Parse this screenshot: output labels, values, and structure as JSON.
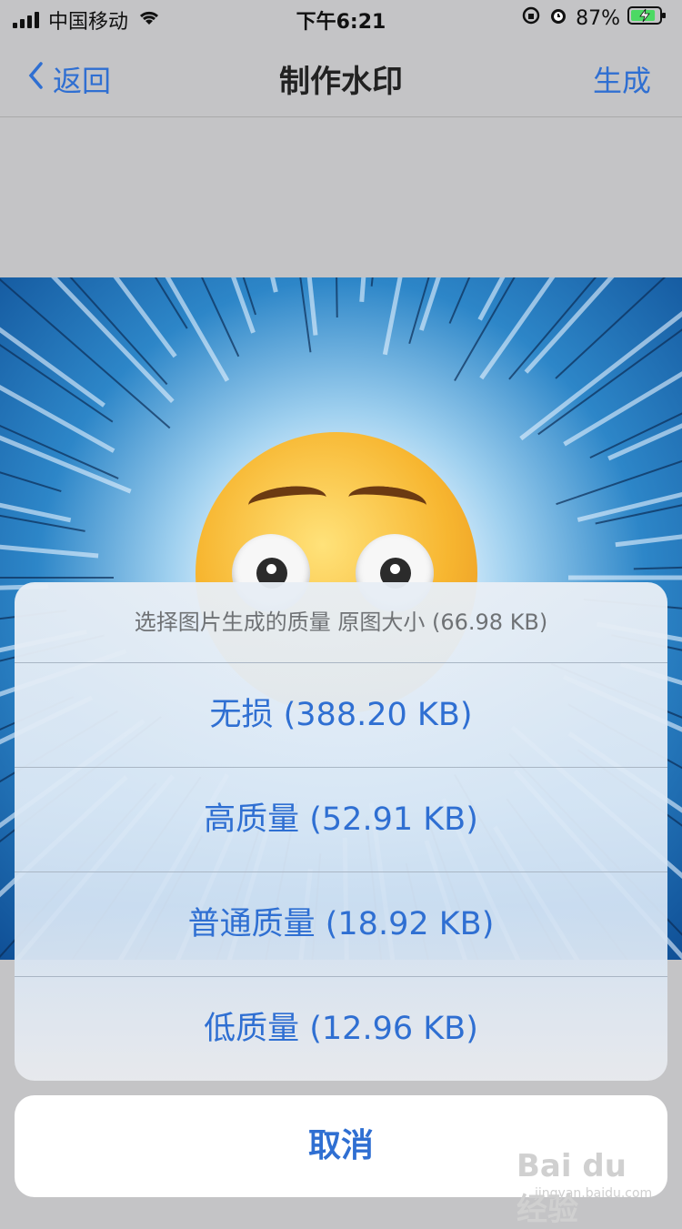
{
  "status_bar": {
    "carrier": "中国移动",
    "time": "下午6:21",
    "battery_percent": "87%",
    "battery_level": 0.87
  },
  "nav": {
    "back_label": "返回",
    "title": "制作水印",
    "action_label": "生成"
  },
  "action_sheet": {
    "title": "选择图片生成的质量 原图大小 (66.98 KB)",
    "options": [
      {
        "label": "无损 (388.20 KB)"
      },
      {
        "label": "高质量 (52.91 KB)"
      },
      {
        "label": "普通质量 (18.92 KB)"
      },
      {
        "label": "低质量 (12.96 KB)"
      }
    ],
    "cancel_label": "取消"
  },
  "watermark": {
    "text": "Bai du 经验",
    "subtext": "jingyan.baidu.com"
  },
  "colors": {
    "accent": "#2f6fd2",
    "page_background": "#c4c4c6"
  },
  "icons": [
    "signal-icon",
    "wifi-icon",
    "lock-rotation-icon",
    "alarm-icon",
    "battery-charging-icon",
    "chevron-left-icon",
    "emoji-flushed-face"
  ]
}
